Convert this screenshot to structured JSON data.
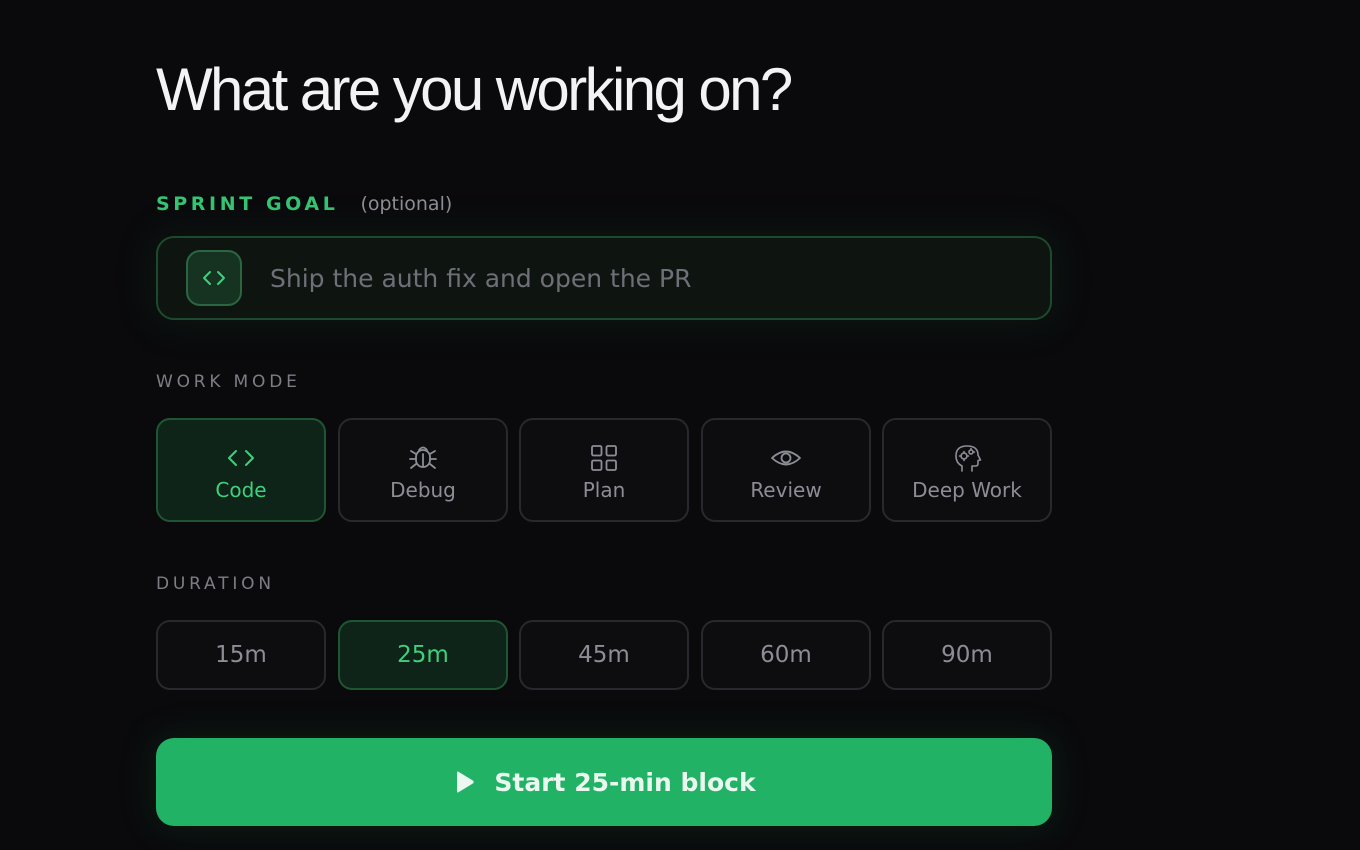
{
  "page": {
    "title": "What are you working on?"
  },
  "goal": {
    "label": "SPRINT GOAL",
    "optional_hint": "(optional)",
    "icon": "code-brackets-icon",
    "value": "",
    "placeholder": "Ship the auth fix and open the PR"
  },
  "work_mode": {
    "label": "WORK MODE",
    "selected": "Code",
    "options": [
      {
        "label": "Code",
        "icon": "code-icon",
        "selected": true
      },
      {
        "label": "Debug",
        "icon": "bug-icon",
        "selected": false
      },
      {
        "label": "Plan",
        "icon": "grid-icon",
        "selected": false
      },
      {
        "label": "Review",
        "icon": "eye-icon",
        "selected": false
      },
      {
        "label": "Deep Work",
        "icon": "brain-gears-icon",
        "selected": false
      }
    ]
  },
  "duration": {
    "label": "DURATION",
    "selected": "25m",
    "options": [
      {
        "label": "15m",
        "selected": false
      },
      {
        "label": "25m",
        "selected": true
      },
      {
        "label": "45m",
        "selected": false
      },
      {
        "label": "60m",
        "selected": false
      },
      {
        "label": "90m",
        "selected": false
      }
    ]
  },
  "start_button": {
    "label": "Start 25-min block",
    "icon": "play-icon"
  },
  "colors": {
    "background": "#0a0a0c",
    "accent": "#21b266",
    "accent_text": "#3fd07e",
    "muted_text": "#8d8d96"
  }
}
